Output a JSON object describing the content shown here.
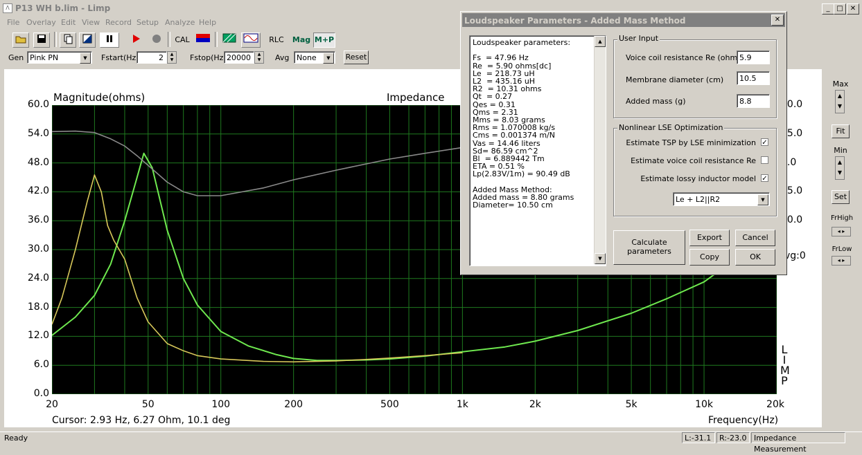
{
  "window": {
    "title": "P13 WH b.lim - Limp",
    "min_glyph": "_",
    "max_glyph": "□",
    "close_glyph": "✕"
  },
  "menu": [
    "File",
    "Overlay",
    "Edit",
    "View",
    "Record",
    "Setup",
    "Analyze",
    "Help"
  ],
  "toolbar": {
    "cal_label": "CAL",
    "rlc_label": "RLC",
    "mag_label": "Mag",
    "mp_label": "M+P"
  },
  "gen_row": {
    "gen_label": "Gen",
    "gen_value": "Pink PN",
    "fstart_label": "Fstart(Hz)",
    "fstart_value": "2",
    "fstop_label": "Fstop(Hz)",
    "fstop_value": "20000",
    "avg_label": "Avg",
    "avg_value": "None",
    "reset_label": "Reset"
  },
  "right_panel": {
    "max_label": "Max",
    "fit_label": "Fit",
    "min_label": "Min",
    "set_label": "Set",
    "frhigh_label": "FrHigh",
    "frlow_label": "FrLow"
  },
  "chart": {
    "ylabel": "Magnitude(ohms)",
    "title": "Impedance",
    "xlabel": "Frequency(Hz)",
    "cursor": "Cursor: 2.93 Hz, 6.27 Ohm, 10.1 deg",
    "y_ticks": [
      "60.0",
      "54.0",
      "48.0",
      "42.0",
      "36.0",
      "30.0",
      "24.0",
      "18.0",
      "12.0",
      "6.0",
      "0.0"
    ],
    "x_ticks": [
      "20",
      "50",
      "100",
      "200",
      "500",
      "1k",
      "2k",
      "5k",
      "10k",
      "20k"
    ],
    "right_ticks": [
      "90.0",
      "45.0",
      "0.0",
      "45.0",
      "90.0"
    ],
    "avg_text": "vg:0",
    "side_letters": [
      "L",
      "I",
      "M",
      "P"
    ]
  },
  "chart_data": {
    "type": "line",
    "title": "Impedance",
    "xlabel": "Frequency(Hz)",
    "ylabel": "Magnitude(ohms)",
    "xscale": "log",
    "xlim": [
      20,
      20000
    ],
    "ylim": [
      0,
      60
    ],
    "grid": true,
    "series": [
      {
        "color": "#6fe94f",
        "x": [
          20,
          25,
          30,
          35,
          40,
          45,
          48,
          52,
          60,
          70,
          80,
          100,
          130,
          170,
          200,
          250,
          300,
          400,
          500,
          700,
          1000,
          1500,
          2000,
          3000,
          5000,
          7000,
          10000,
          11000
        ],
        "values": [
          12.2,
          16,
          20.5,
          27,
          36,
          45,
          50,
          47,
          34,
          24,
          18.5,
          13,
          10,
          8.2,
          7.4,
          7,
          7,
          7.1,
          7.3,
          7.9,
          8.8,
          9.8,
          11,
          13.2,
          16.8,
          19.8,
          23.3,
          24.8
        ]
      },
      {
        "color": "#d8c85a",
        "x": [
          20,
          22,
          25,
          28,
          30,
          32,
          34,
          36,
          40,
          45,
          50,
          60,
          70,
          80,
          100,
          150,
          200,
          300,
          400,
          500,
          700,
          1000
        ],
        "values": [
          14.5,
          20,
          30,
          40,
          45.5,
          42,
          35,
          32,
          28,
          20,
          15,
          10.5,
          9,
          8,
          7.3,
          6.8,
          6.7,
          6.9,
          7.2,
          7.5,
          8,
          8.6
        ]
      },
      {
        "color": "#8a8a8a",
        "x": [
          20,
          25,
          30,
          35,
          40,
          45,
          50,
          60,
          70,
          80,
          100,
          150,
          200,
          300,
          500,
          700,
          1000,
          1500,
          2000
        ],
        "values": [
          54.5,
          54.6,
          54.3,
          53,
          51.5,
          49.5,
          47.5,
          44,
          42,
          41.2,
          41.2,
          42.8,
          44.5,
          46.5,
          48.8,
          50,
          51.2,
          52.3,
          53
        ]
      }
    ]
  },
  "status": {
    "ready": "Ready",
    "l_value": "L:-31.1",
    "r_value": "R:-23.0",
    "mode": "Impedance Measurement"
  },
  "dialog": {
    "title": "Loudspeaker Parameters - Added Mass Method",
    "close_glyph": "✕",
    "params_lines": [
      "Loudspeaker parameters:",
      "",
      "Fs  = 47.96 Hz",
      "Re  = 5.90 ohms[dc]",
      "Le  = 218.73 uH",
      "L2  = 435.16 uH",
      "R2  = 10.31 ohms",
      "Qt  = 0.27",
      "Qes = 0.31",
      "Qms = 2.31",
      "Mms = 8.03 grams",
      "Rms = 1.070008 kg/s",
      "Cms = 0.001374 m/N",
      "Vas = 14.46 liters",
      "Sd= 86.59 cm^2",
      "Bl  = 6.889442 Tm",
      "ETA = 0.51 %",
      "Lp(2.83V/1m) = 90.49 dB",
      "",
      "Added Mass Method:",
      "Added mass = 8.80 grams",
      "Diameter= 10.50 cm"
    ],
    "user_input": {
      "title": "User Input",
      "re_label": "Voice coil resistance Re (ohms)",
      "re_value": "5.9",
      "diam_label": "Membrane diameter (cm)",
      "diam_value": "10.5",
      "mass_label": "Added mass (g)",
      "mass_value": "8.8"
    },
    "lse": {
      "title": "Nonlinear LSE Optimization",
      "tsp_label": "Estimate TSP by LSE minimization",
      "tsp_checked": true,
      "re_label": "Estimate voice coil resistance Re",
      "re_checked": false,
      "lossy_label": "Estimate lossy inductor model",
      "lossy_checked": true,
      "model_value": "Le + L2||R2"
    },
    "buttons": {
      "calculate": "Calculate\nparameters",
      "export": "Export",
      "cancel": "Cancel",
      "copy": "Copy",
      "ok": "OK"
    }
  }
}
